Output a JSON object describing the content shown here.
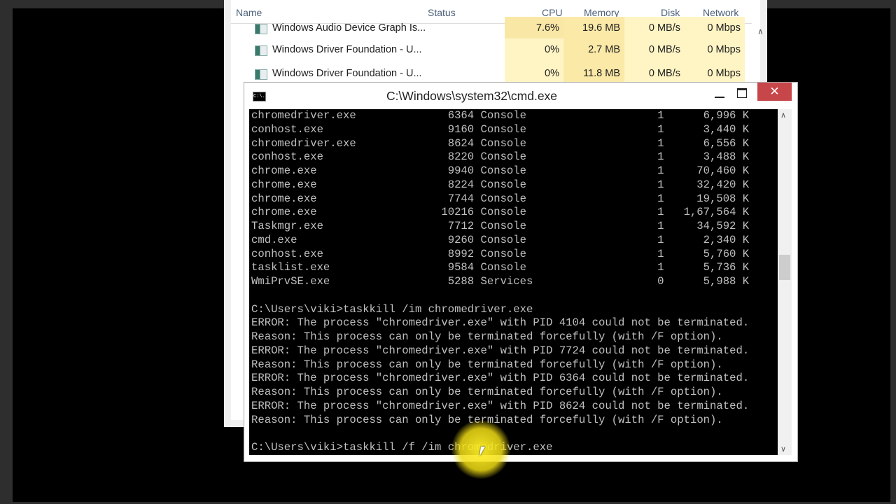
{
  "task_manager": {
    "columns": [
      "Name",
      "Status",
      "CPU",
      "Memory",
      "Disk",
      "Network"
    ],
    "rows": [
      {
        "name": "Windows Audio Device Graph Is...",
        "cpu": "7.6%",
        "memory": "19.6 MB",
        "disk": "0 MB/s",
        "network": "0 Mbps"
      },
      {
        "name": "Windows Driver Foundation - U...",
        "cpu": "0%",
        "memory": "2.7 MB",
        "disk": "0 MB/s",
        "network": "0 Mbps"
      },
      {
        "name": "Windows Driver Foundation - U...",
        "cpu": "0%",
        "memory": "11.8 MB",
        "disk": "0 MB/s",
        "network": "0 Mbps"
      }
    ],
    "partial_text": "V"
  },
  "cmd": {
    "title": "C:\\Windows\\system32\\cmd.exe",
    "icon_label": "C:\\.",
    "close_glyph": "✕",
    "processes": [
      [
        "chromedriver.exe",
        "6364",
        "Console",
        "1",
        "6,996 K"
      ],
      [
        "conhost.exe",
        "9160",
        "Console",
        "1",
        "3,440 K"
      ],
      [
        "chromedriver.exe",
        "8624",
        "Console",
        "1",
        "6,556 K"
      ],
      [
        "conhost.exe",
        "8220",
        "Console",
        "1",
        "3,488 K"
      ],
      [
        "chrome.exe",
        "9940",
        "Console",
        "1",
        "70,460 K"
      ],
      [
        "chrome.exe",
        "8224",
        "Console",
        "1",
        "32,420 K"
      ],
      [
        "chrome.exe",
        "7744",
        "Console",
        "1",
        "19,508 K"
      ],
      [
        "chrome.exe",
        "10216",
        "Console",
        "1",
        "1,67,564 K"
      ],
      [
        "Taskmgr.exe",
        "7712",
        "Console",
        "1",
        "34,592 K"
      ],
      [
        "cmd.exe",
        "9260",
        "Console",
        "1",
        "2,340 K"
      ],
      [
        "conhost.exe",
        "8992",
        "Console",
        "1",
        "5,760 K"
      ],
      [
        "tasklist.exe",
        "9584",
        "Console",
        "1",
        "5,736 K"
      ],
      [
        "WmiPrvSE.exe",
        "5288",
        "Services",
        "0",
        "5,988 K"
      ]
    ],
    "output_lines": [
      "",
      "C:\\Users\\viki>taskkill /im chromedriver.exe",
      "ERROR: The process \"chromedriver.exe\" with PID 4104 could not be terminated.",
      "Reason: This process can only be terminated forcefully (with /F option).",
      "ERROR: The process \"chromedriver.exe\" with PID 7724 could not be terminated.",
      "Reason: This process can only be terminated forcefully (with /F option).",
      "ERROR: The process \"chromedriver.exe\" with PID 6364 could not be terminated.",
      "Reason: This process can only be terminated forcefully (with /F option).",
      "ERROR: The process \"chromedriver.exe\" with PID 8624 could not be terminated.",
      "Reason: This process can only be terminated forcefully (with /F option).",
      "",
      "C:\\Users\\viki>taskkill /f /im chromedriver.exe"
    ]
  },
  "colors": {
    "console_bg": "#000000",
    "console_text": "#c0c0c0",
    "close_button": "#c7464a",
    "heat_cell": "#fff4c4"
  }
}
